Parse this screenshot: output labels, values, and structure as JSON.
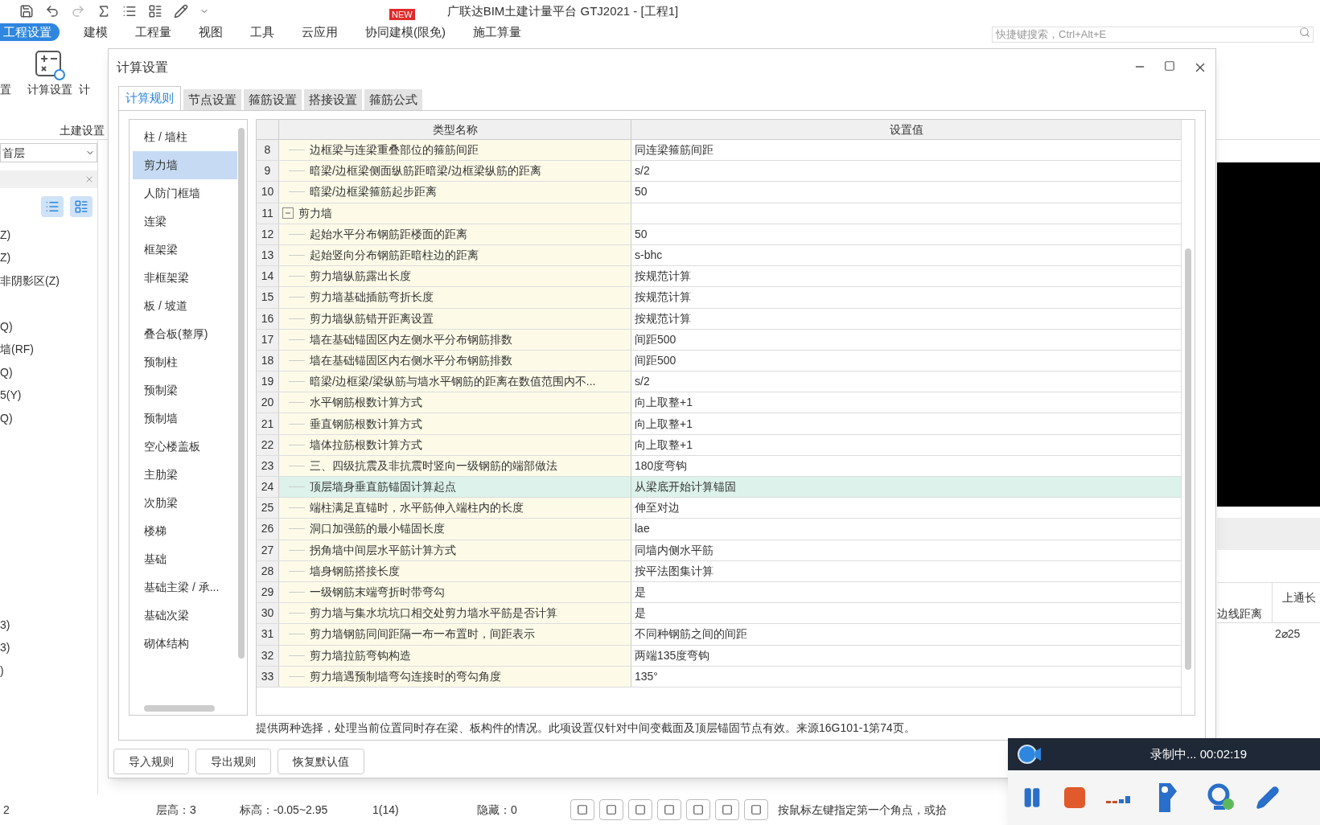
{
  "app": {
    "title": "广联达BIM土建计量平台 GTJ2021 - [工程1]",
    "new_badge": "NEW",
    "search_placeholder": "快捷键搜索，Ctrl+Alt+E",
    "menu": [
      {
        "label": "工程设置",
        "selected": true
      },
      {
        "label": "建模",
        "selected": false
      },
      {
        "label": "工程量",
        "selected": false
      },
      {
        "label": "视图",
        "selected": false
      },
      {
        "label": "工具",
        "selected": false
      },
      {
        "label": "云应用",
        "selected": false
      },
      {
        "label": "协同建模(限免)",
        "selected": false
      },
      {
        "label": "施工算量",
        "selected": false
      }
    ],
    "ribbon": {
      "left_label": "置",
      "buttons": [
        "计算设置",
        "计"
      ],
      "group_label": "土建设置"
    },
    "floor_select": "首层",
    "tree_groups": [
      [
        "Z)",
        "Z)",
        "非阴影区(Z)"
      ],
      [
        "Q)",
        "墙(RF)",
        "Q)",
        "5(Y)",
        "Q)"
      ],
      [
        "3)",
        "3)",
        ")"
      ]
    ],
    "grid": {
      "columns": [
        "边线距离",
        "上通长"
      ],
      "cell": "2⌀25"
    },
    "status_bar": {
      "items": [
        "2",
        "层高：3",
        "标高：-0.05~2.95",
        "1(14)",
        "隐藏：0"
      ],
      "prompt": "按鼠标左键指定第一个角点，或拾"
    }
  },
  "dialog": {
    "title": "计算设置",
    "tabs": [
      {
        "label": "计算规则",
        "selected": true
      },
      {
        "label": "节点设置",
        "selected": false
      },
      {
        "label": "箍筋设置",
        "selected": false
      },
      {
        "label": "搭接设置",
        "selected": false
      },
      {
        "label": "箍筋公式",
        "selected": false
      }
    ],
    "categories": [
      {
        "label": "柱 / 墙柱",
        "selected": false
      },
      {
        "label": "剪力墙",
        "selected": true
      },
      {
        "label": "人防门框墙",
        "selected": false
      },
      {
        "label": "连梁",
        "selected": false
      },
      {
        "label": "框架梁",
        "selected": false
      },
      {
        "label": "非框架梁",
        "selected": false
      },
      {
        "label": "板 / 坡道",
        "selected": false
      },
      {
        "label": "叠合板(整厚)",
        "selected": false
      },
      {
        "label": "预制柱",
        "selected": false
      },
      {
        "label": "预制梁",
        "selected": false
      },
      {
        "label": "预制墙",
        "selected": false
      },
      {
        "label": "空心楼盖板",
        "selected": false
      },
      {
        "label": "主肋梁",
        "selected": false
      },
      {
        "label": "次肋梁",
        "selected": false
      },
      {
        "label": "楼梯",
        "selected": false
      },
      {
        "label": "基础",
        "selected": false
      },
      {
        "label": "基础主梁 / 承...",
        "selected": false
      },
      {
        "label": "基础次梁",
        "selected": false
      },
      {
        "label": "砌体结构",
        "selected": false
      }
    ],
    "table": {
      "columns": [
        "类型名称",
        "设置值"
      ],
      "rows": [
        {
          "no": "8",
          "kind": "item",
          "name": "边框梁与连梁重叠部位的箍筋间距",
          "value": "同连梁箍筋间距",
          "selected": false
        },
        {
          "no": "9",
          "kind": "item",
          "name": "暗梁/边框梁侧面纵筋距暗梁/边框梁纵筋的距离",
          "value": "s/2",
          "selected": false
        },
        {
          "no": "10",
          "kind": "item",
          "name": "暗梁/边框梁箍筋起步距离",
          "value": "50",
          "selected": false
        },
        {
          "no": "11",
          "kind": "group",
          "name": "剪力墙",
          "value": "",
          "expanded": true,
          "selected": false
        },
        {
          "no": "12",
          "kind": "item",
          "name": "起始水平分布钢筋距楼面的距离",
          "value": "50",
          "selected": false
        },
        {
          "no": "13",
          "kind": "item",
          "name": "起始竖向分布钢筋距暗柱边的距离",
          "value": "s-bhc",
          "selected": false
        },
        {
          "no": "14",
          "kind": "item",
          "name": "剪力墙纵筋露出长度",
          "value": "按规范计算",
          "selected": false
        },
        {
          "no": "15",
          "kind": "item",
          "name": "剪力墙基础插筋弯折长度",
          "value": "按规范计算",
          "selected": false
        },
        {
          "no": "16",
          "kind": "item",
          "name": "剪力墙纵筋错开距离设置",
          "value": "按规范计算",
          "selected": false
        },
        {
          "no": "17",
          "kind": "item",
          "name": "墙在基础锚固区内左侧水平分布钢筋排数",
          "value": "间距500",
          "selected": false
        },
        {
          "no": "18",
          "kind": "item",
          "name": "墙在基础锚固区内右侧水平分布钢筋排数",
          "value": "间距500",
          "selected": false
        },
        {
          "no": "19",
          "kind": "item",
          "name": "暗梁/边框梁/梁纵筋与墙水平钢筋的距离在数值范围内不...",
          "value": "s/2",
          "selected": false
        },
        {
          "no": "20",
          "kind": "item",
          "name": "水平钢筋根数计算方式",
          "value": "向上取整+1",
          "selected": false
        },
        {
          "no": "21",
          "kind": "item",
          "name": "垂直钢筋根数计算方式",
          "value": "向上取整+1",
          "selected": false
        },
        {
          "no": "22",
          "kind": "item",
          "name": "墙体拉筋根数计算方式",
          "value": "向上取整+1",
          "selected": false
        },
        {
          "no": "23",
          "kind": "item",
          "name": "三、四级抗震及非抗震时竖向一级钢筋的端部做法",
          "value": "180度弯钩",
          "selected": false
        },
        {
          "no": "24",
          "kind": "item",
          "name": "顶层墙身垂直筋锚固计算起点",
          "value": "从梁底开始计算锚固",
          "selected": true
        },
        {
          "no": "25",
          "kind": "item",
          "name": "端柱满足直锚时，水平筋伸入端柱内的长度",
          "value": "伸至对边",
          "selected": false
        },
        {
          "no": "26",
          "kind": "item",
          "name": "洞口加强筋的最小锚固长度",
          "value": "lae",
          "selected": false
        },
        {
          "no": "27",
          "kind": "item",
          "name": "拐角墙中间层水平筋计算方式",
          "value": "同墙内侧水平筋",
          "selected": false
        },
        {
          "no": "28",
          "kind": "item",
          "name": "墙身钢筋搭接长度",
          "value": "按平法图集计算",
          "selected": false
        },
        {
          "no": "29",
          "kind": "item",
          "name": "一级钢筋末端弯折时带弯勾",
          "value": "是",
          "selected": false
        },
        {
          "no": "30",
          "kind": "item",
          "name": "剪力墙与集水坑坑口相交处剪力墙水平筋是否计算",
          "value": "是",
          "selected": false
        },
        {
          "no": "31",
          "kind": "item",
          "name": "剪力墙钢筋同间距隔一布一布置时，间距表示",
          "value": "不同种钢筋之间的间距",
          "selected": false
        },
        {
          "no": "32",
          "kind": "item",
          "name": "剪力墙拉筋弯钩构造",
          "value": "两端135度弯钩",
          "selected": false
        },
        {
          "no": "33",
          "kind": "item",
          "name": "剪力墙遇预制墙弯勾连接时的弯勾角度",
          "value": "135°",
          "selected": false
        }
      ]
    },
    "description": "提供两种选择，处理当前位置同时存在梁、板构件的情况。此项设置仅针对中间变截面及顶层锚固节点有效。来源16G101-1第74页。",
    "buttons": [
      "导入规则",
      "导出规则",
      "恢复默认值"
    ]
  },
  "recorder": {
    "status": "录制中... 00:02:19"
  }
}
